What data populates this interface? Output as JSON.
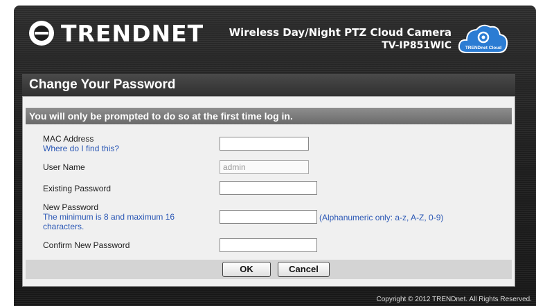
{
  "header": {
    "logo_text": "TRENDNET",
    "product_name": "Wireless Day/Night PTZ Cloud Camera",
    "model": "TV-IP851WIC",
    "cloud_badge": "TRENDnet Cloud"
  },
  "panel": {
    "title": "Change Your Password",
    "notice": "You will only be prompted to do so at the first time log in."
  },
  "form": {
    "mac_label": "MAC Address",
    "mac_help": "Where do I find this?",
    "mac_value": "",
    "username_label": "User Name",
    "username_value": "admin",
    "existing_label": "Existing Password",
    "existing_value": "",
    "new_label": "New Password",
    "new_help_line1": "The minimum is 8 and maximum 16",
    "new_help_line2": "characters.",
    "new_value": "",
    "new_hint": "(Alphanumeric only: a-z, A-Z, 0-9)",
    "confirm_label": "Confirm New Password",
    "confirm_value": ""
  },
  "buttons": {
    "ok": "OK",
    "cancel": "Cancel"
  },
  "footer": {
    "copyright": "Copyright © 2012 TRENDnet.  All Rights Reserved."
  },
  "colors": {
    "link": "#2a57b5",
    "title_bar": "#3a3a3a",
    "notice_bar": "#7c7c7c",
    "cloud_blue": "#2b7cd3"
  }
}
